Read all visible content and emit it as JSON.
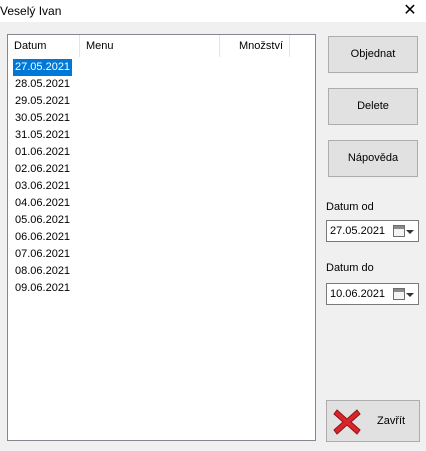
{
  "window": {
    "title": "Veselý Ivan"
  },
  "list": {
    "columns": [
      "Datum",
      "Menu",
      "Množství"
    ],
    "rows": [
      "27.05.2021",
      "28.05.2021",
      "29.05.2021",
      "30.05.2021",
      "31.05.2021",
      "01.06.2021",
      "02.06.2021",
      "03.06.2021",
      "04.06.2021",
      "05.06.2021",
      "06.06.2021",
      "07.06.2021",
      "08.06.2021",
      "09.06.2021"
    ],
    "selected_index": 0
  },
  "buttons": {
    "order": "Objednat",
    "delete": "Delete",
    "help": "Nápověda",
    "close": "Zavřít"
  },
  "filters": {
    "from_label": "Datum od",
    "from_value": "27.05.2021",
    "to_label": "Datum do",
    "to_value": "10.06.2021"
  },
  "icons": {
    "window_close": "close-icon",
    "close_button": "red-x-icon",
    "date_picker": "calendar-icon"
  },
  "colors": {
    "selection": "#0078d7",
    "close_icon": "#d9252a",
    "panel_bg": "#f0f0f0"
  }
}
